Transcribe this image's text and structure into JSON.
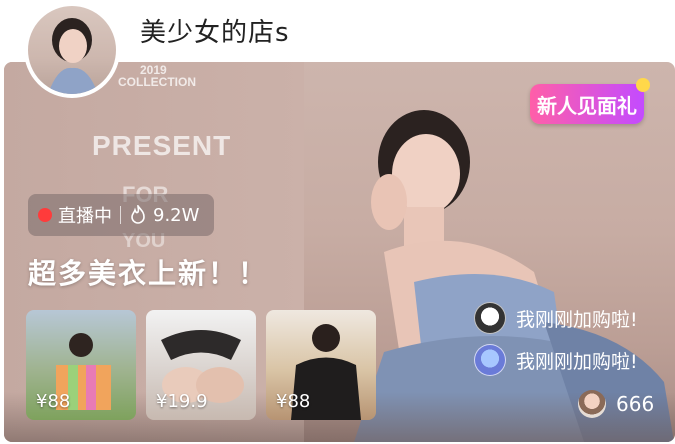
{
  "shop": {
    "name": "美少女的店s"
  },
  "banner": {
    "collection_year": "2019",
    "collection_label": "COLLECTION",
    "bg_word_1": "PRESENT",
    "bg_word_2": "FOR",
    "bg_word_3": "YOU",
    "new_gift": "新人见面礼",
    "live_status": "直播中",
    "heat_count": "9.2W",
    "headline": "超多美衣上新！！"
  },
  "products": [
    {
      "price": "¥88"
    },
    {
      "price": "¥19.9"
    },
    {
      "price": "¥88"
    }
  ],
  "cart_messages": [
    {
      "text": "我刚刚加购啦!"
    },
    {
      "text": "我刚刚加购啦!"
    }
  ],
  "viewers": {
    "count": "666"
  },
  "icons": [
    "live-dot-icon",
    "fire-icon"
  ],
  "colors": {
    "live_dot": "#ff3b3b",
    "gift_gradient_start": "#ff5fa8",
    "gift_gradient_end": "#c34bff"
  }
}
